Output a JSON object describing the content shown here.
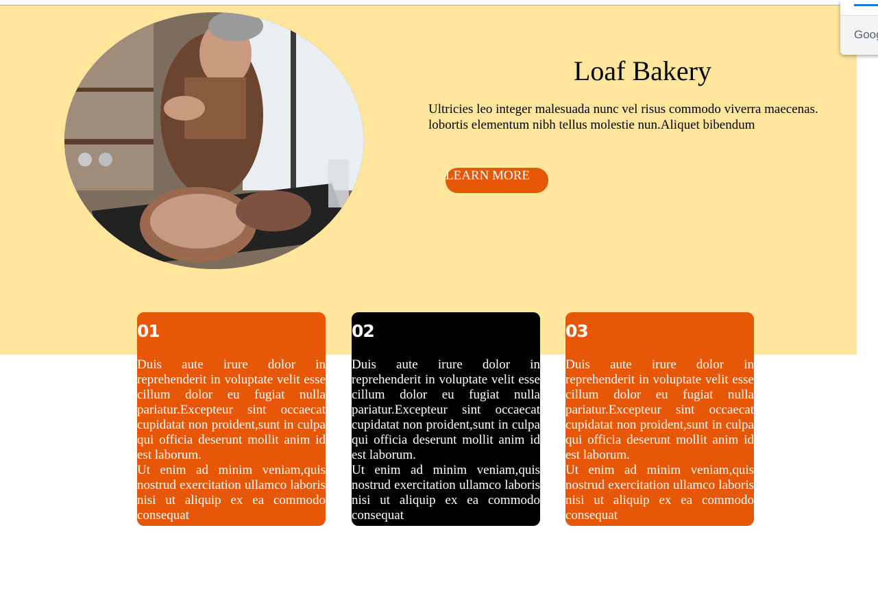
{
  "hero": {
    "title": "Loaf Bakery",
    "description": "Ultricies leo integer malesuada nunc vel risus commodo viverra maecenas. lobortis elementum nibh tellus molestie nun.Aliquet bibendum",
    "button_label": "LEARN MORE",
    "image": "baker-sprinkling-flour-on-bread-photo"
  },
  "cards": [
    {
      "number": "01",
      "paragraph1": "Duis aute irure dolor in reprehenderit in voluptate velit esse cillum dolor eu fugiat nulla pariatur.Excepteur sint occaecat cupidatat non proident,sunt in culpa qui officia deserunt mollit anim id est laborum.",
      "paragraph2": "Ut enim ad minim veniam,quis nostrud exercitation ullamco laboris nisi ut aliquip ex ea commodo consequat",
      "color": "#e65708"
    },
    {
      "number": "02",
      "paragraph1": "Duis aute irure dolor in reprehenderit in voluptate velit esse cillum dolor eu fugiat nulla pariatur.Excepteur sint occaecat cupidatat non proident,sunt in culpa qui officia deserunt mollit anim id est laborum.",
      "paragraph2": "Ut enim ad minim veniam,quis nostrud exercitation ullamco laboris nisi ut aliquip ex ea commodo consequat",
      "color": "#000000"
    },
    {
      "number": "03",
      "paragraph1": "Duis aute irure dolor in reprehenderit in voluptate velit esse cillum dolor eu fugiat nulla pariatur.Excepteur sint occaecat cupidatat non proident,sunt in culpa qui officia deserunt mollit anim id est laborum.",
      "paragraph2": "Ut enim ad minim veniam,quis nostrud exercitation ullamco laboris nisi ut aliquip ex ea commodo consequat",
      "color": "#e65708"
    }
  ],
  "popup": {
    "label": "Goog"
  },
  "colors": {
    "hero_background": "#ffe69c",
    "accent": "#e65708",
    "dark_card": "#000000"
  }
}
